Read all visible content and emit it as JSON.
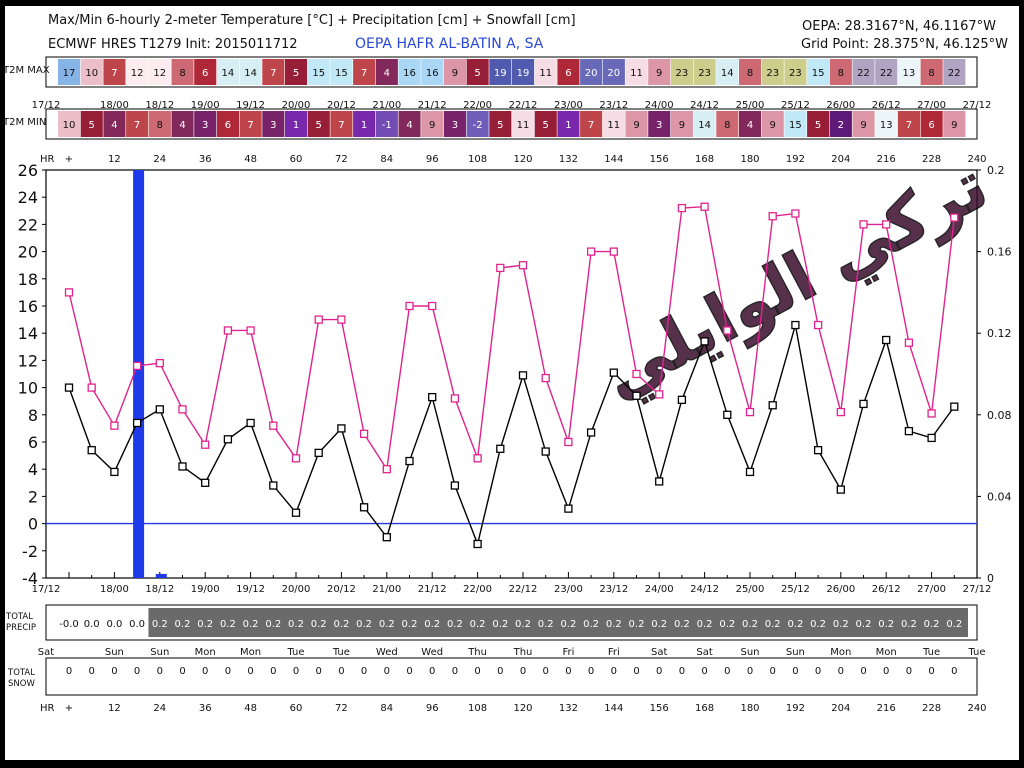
{
  "header": {
    "title": "Max/Min 6-hourly 2-meter Temperature [°C] + Precipitation [cm] + Snowfall [cm]",
    "model": "ECMWF HRES T1279 Init: 2015011712",
    "station": "OEPA HAFR AL-BATIN A, SA",
    "station_coords": "OEPA: 28.3167°N, 46.1167°W",
    "grid_point": "Grid Point: 28.375°N, 46.125°W"
  },
  "watermark": "تركي الوايلي",
  "colors": {
    "max_line": "#e0238e",
    "min_line": "#000000",
    "precip_bar": "#1f3ae8",
    "zero_line": "#1f3ae8",
    "precip_row_fill": "#6a6a6a"
  },
  "chart_data": {
    "type": "line",
    "x": [
      0,
      6,
      12,
      18,
      24,
      30,
      36,
      42,
      48,
      54,
      60,
      66,
      72,
      78,
      84,
      90,
      96,
      102,
      108,
      114,
      120,
      126,
      132,
      138,
      144,
      150,
      156,
      162,
      168,
      174,
      180,
      186,
      192,
      198,
      204,
      210,
      216,
      222,
      228,
      234,
      240
    ],
    "xlabel": "HR",
    "ylim": [
      -4,
      26
    ],
    "y_ticks": [
      -4,
      -2,
      0,
      2,
      4,
      6,
      8,
      10,
      12,
      14,
      16,
      18,
      20,
      22,
      24,
      26
    ],
    "y2lim": [
      0,
      0.2
    ],
    "y2_ticks": [
      "0",
      "0.04",
      "0.08",
      "0.12",
      "0.16",
      "0.2"
    ],
    "series": [
      {
        "values": [
          17,
          10,
          7.2,
          11.6,
          11.8,
          8.4,
          5.8,
          14.2,
          14.2,
          7.2,
          4.8,
          15,
          15,
          6.6,
          4,
          16,
          16,
          9.2,
          4.8,
          18.8,
          19,
          10.7,
          6,
          20,
          20,
          11,
          9.5,
          23.2,
          23.3,
          14.2,
          8.2,
          22.6,
          22.8,
          14.6,
          8.2,
          22,
          22,
          13.3,
          8.1,
          22.5
        ]
      },
      {
        "values": [
          10,
          5.4,
          3.8,
          7.4,
          8.4,
          4.2,
          3,
          6.2,
          7.4,
          2.8,
          0.8,
          5.2,
          7,
          1.2,
          -1,
          4.6,
          9.3,
          2.8,
          -1.5,
          5.5,
          10.9,
          5.3,
          1.1,
          6.7,
          11.1,
          9.4,
          3.1,
          9.1,
          13.4,
          8,
          3.8,
          8.7,
          14.6,
          5.4,
          2.5,
          8.8,
          13.5,
          6.8,
          6.3,
          8.6
        ]
      },
      {
        "values": [
          0.2,
          0.002
        ]
      }
    ],
    "date_labels": [
      "17/12",
      "18/00",
      "18/12",
      "19/00",
      "19/12",
      "20/00",
      "20/12",
      "21/00",
      "21/12",
      "22/00",
      "22/12",
      "23/00",
      "23/12",
      "24/00",
      "24/12",
      "25/00",
      "25/12",
      "26/00",
      "26/12",
      "27/00",
      "27/12"
    ],
    "day_labels": [
      "Sat",
      "Sun",
      "Sun",
      "Mon",
      "Mon",
      "Tue",
      "Tue",
      "Wed",
      "Wed",
      "Thu",
      "Thu",
      "Fri",
      "Fri",
      "Sat",
      "Sat",
      "Sun",
      "Sun",
      "Mon",
      "Mon",
      "Tue",
      "Tue"
    ],
    "hr_labels": [
      "+",
      "12",
      "24",
      "36",
      "48",
      "60",
      "72",
      "84",
      "96",
      "108",
      "120",
      "132",
      "144",
      "156",
      "168",
      "180",
      "192",
      "204",
      "216",
      "228",
      "240"
    ],
    "t2m_max": {
      "label": "T2M MAX",
      "values": [
        17,
        10,
        7,
        12,
        12,
        8,
        6,
        14,
        14,
        7,
        5,
        15,
        15,
        7,
        4,
        16,
        16,
        9,
        5,
        19,
        19,
        11,
        6,
        20,
        20,
        11,
        9,
        23,
        23,
        14,
        8,
        23,
        23,
        15,
        8,
        22,
        22,
        13,
        8,
        22
      ]
    },
    "t2m_min": {
      "label": "T2M MIN",
      "values": [
        10,
        5,
        4,
        7,
        8,
        4,
        3,
        6,
        7,
        3,
        1,
        5,
        7,
        1,
        -1,
        4,
        9,
        3,
        -2,
        5,
        11,
        5,
        1,
        7,
        11,
        9,
        3,
        9,
        14,
        8,
        4,
        9,
        15,
        5,
        2,
        9,
        13,
        7,
        6,
        9
      ]
    },
    "total_precip": {
      "label": "TOTAL PRECIP",
      "values": [
        "-0.0",
        "0.0",
        "0.0",
        "0.0",
        "0.2",
        "0.2",
        "0.2",
        "0.2",
        "0.2",
        "0.2",
        "0.2",
        "0.2",
        "0.2",
        "0.2",
        "0.2",
        "0.2",
        "0.2",
        "0.2",
        "0.2",
        "0.2",
        "0.2",
        "0.2",
        "0.2",
        "0.2",
        "0.2",
        "0.2",
        "0.2",
        "0.2",
        "0.2",
        "0.2",
        "0.2",
        "0.2",
        "0.2",
        "0.2",
        "0.2",
        "0.2",
        "0.2",
        "0.2",
        "0.2",
        "0.2"
      ]
    },
    "total_snow": {
      "label": "TOTAL SNOW",
      "values": [
        "0",
        "0",
        "0",
        "0",
        "0",
        "0",
        "0",
        "0",
        "0",
        "0",
        "0",
        "0",
        "0",
        "0",
        "0",
        "0",
        "0",
        "0",
        "0",
        "0",
        "0",
        "0",
        "0",
        "0",
        "0",
        "0",
        "0",
        "0",
        "0",
        "0",
        "0",
        "0",
        "0",
        "0",
        "0",
        "0",
        "0",
        "0",
        "0",
        "0"
      ]
    }
  }
}
